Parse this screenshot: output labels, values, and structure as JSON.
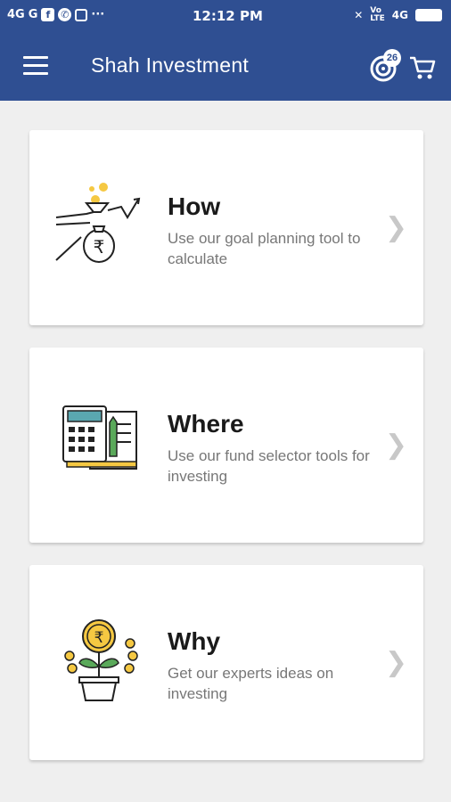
{
  "status_bar": {
    "network": "4G",
    "network2": "G",
    "more": "···",
    "time": "12:12 PM",
    "right_network": "4G"
  },
  "app_bar": {
    "title": "Shah Investment",
    "badge_count": "26"
  },
  "cards": [
    {
      "title": "How",
      "description": "Use our goal planning tool to calculate",
      "icon": "money-bag-growth-icon"
    },
    {
      "title": "Where",
      "description": "Use our fund selector tools for investing",
      "icon": "calculator-document-icon"
    },
    {
      "title": "Why",
      "description": "Get our experts ideas on investing",
      "icon": "money-plant-icon"
    }
  ],
  "colors": {
    "primary": "#2f4f92",
    "background": "#efefef",
    "accent_yellow": "#f5c842",
    "icon_teal": "#5aa7b0",
    "icon_green": "#5aa95a"
  }
}
